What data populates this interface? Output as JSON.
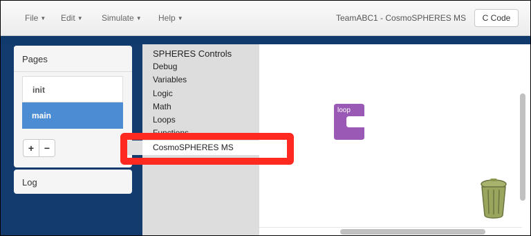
{
  "menubar": {
    "items": [
      {
        "label": "File"
      },
      {
        "label": "Edit"
      },
      {
        "label": "Simulate"
      },
      {
        "label": "Help"
      }
    ],
    "title": "TeamABC1 - CosmoSPHERES MS",
    "ccode_label": "C Code"
  },
  "pages": {
    "title": "Pages",
    "items": [
      {
        "label": "init",
        "selected": false
      },
      {
        "label": "main",
        "selected": true
      }
    ],
    "add_label": "+",
    "remove_label": "−"
  },
  "log": {
    "title": "Log"
  },
  "toolbox": {
    "categories": [
      {
        "label": "SPHERES Controls"
      },
      {
        "label": "Debug"
      },
      {
        "label": "Variables"
      },
      {
        "label": "Logic"
      },
      {
        "label": "Math"
      },
      {
        "label": "Loops"
      },
      {
        "label": "Functions"
      },
      {
        "label": "CosmoSPHERES MS"
      }
    ]
  },
  "workspace": {
    "loop_block_label": "loop",
    "loop_block_color": "#9b59b6"
  },
  "colors": {
    "navy": "#133b6e",
    "selected_blue": "#4b8cd3",
    "highlight_red": "#ff2a1f"
  }
}
